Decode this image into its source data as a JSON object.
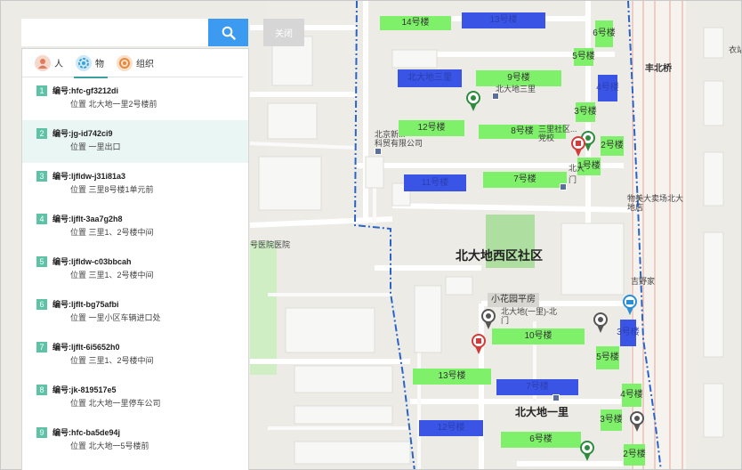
{
  "search": {
    "placeholder": ""
  },
  "buttons": {
    "close_label": "关闭"
  },
  "tabs": [
    {
      "label": "人",
      "icon": "person-icon",
      "color": "#e07a5a"
    },
    {
      "label": "物",
      "icon": "object-icon",
      "color": "#3aa1d8"
    },
    {
      "label": "组织",
      "icon": "organization-icon",
      "color": "#e58a3c"
    }
  ],
  "results": [
    {
      "index": "1",
      "code_label": "编号:",
      "code": "hfc-gf3212di",
      "loc_label": "位置",
      "location": "北大地一里2号楼前"
    },
    {
      "index": "2",
      "code_label": "编号:",
      "code": "jg-id742ci9",
      "loc_label": "位置",
      "location": "一里出口"
    },
    {
      "index": "3",
      "code_label": "编号:",
      "code": "ljfldw-j31i81a3",
      "loc_label": "位置",
      "location": "三里8号楼1单元前"
    },
    {
      "index": "4",
      "code_label": "编号:",
      "code": "ljflt-3aa7g2h8",
      "loc_label": "位置",
      "location": "三里1、2号楼中间"
    },
    {
      "index": "5",
      "code_label": "编号:",
      "code": "ljfldw-c03bbcah",
      "loc_label": "位置",
      "location": "三里1、2号楼中间"
    },
    {
      "index": "6",
      "code_label": "编号:",
      "code": "ljflt-bg75afbi",
      "loc_label": "位置",
      "location": "一里小区车辆进口处"
    },
    {
      "index": "7",
      "code_label": "编号:",
      "code": "ljflt-6i5652h0",
      "loc_label": "位置",
      "location": "三里1、2号楼中间"
    },
    {
      "index": "8",
      "code_label": "编号:",
      "code": "jk-819517e5",
      "loc_label": "位置",
      "location": "北大地一里停车公司"
    },
    {
      "index": "9",
      "code_label": "编号:",
      "code": "hfc-ba5de94j",
      "loc_label": "位置",
      "location": "北大地一5号楼前"
    }
  ],
  "map": {
    "buildings": [
      "14号楼",
      "13号楼",
      "6号楼",
      "9号楼",
      "5号楼",
      "4号楼",
      "3号楼",
      "12号楼",
      "8号楼",
      "2号楼",
      "1号楼",
      "11号楼",
      "7号楼",
      "10号楼",
      "3号楼",
      "13号楼",
      "5号楼",
      "4号楼",
      "7号楼",
      "3号楼",
      "12号楼",
      "6号楼",
      "2号楼",
      "北大地三里"
    ],
    "labels": {
      "north_area": "北大地三里",
      "west_community": "北大地西区社区",
      "first_area": "北大地一里",
      "garden": "小花园平房",
      "road": "丰北桥",
      "poi1": "北大地三里",
      "poi2": "北京新...\n科贸有限公司",
      "poi3": "物美大卖场北大\n地店",
      "poi4": "吉野家",
      "poi5": "北大地(一里)-北\n门",
      "poi6": "号医院医院",
      "poi7": "北大",
      "poi8": "社区",
      "poi9": "衣站",
      "poi10": "三里社区...\n党校",
      "poi11": "北大",
      "poi12": "门"
    }
  },
  "colors": {
    "search_button": "#3c9bf0",
    "accent": "#3aa1a0",
    "index_badge": "#5ec2a6",
    "building_green": "#7ef06a",
    "building_blue": "#3a54e6",
    "boundary": "#2b64c8"
  }
}
